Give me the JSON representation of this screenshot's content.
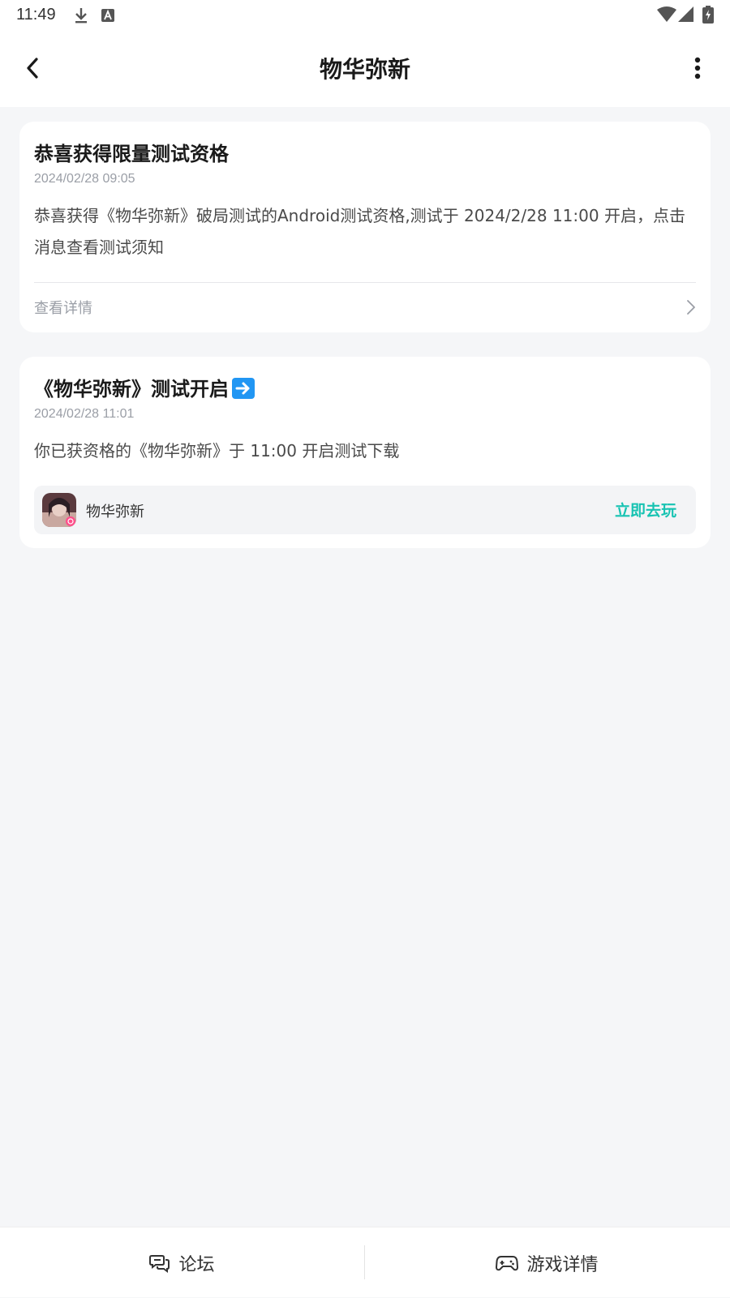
{
  "status_bar": {
    "time": "11:49",
    "icons": [
      "download-icon",
      "a-badge-icon",
      "wifi-icon",
      "signal-icon",
      "battery-icon"
    ]
  },
  "nav": {
    "title": "物华弥新",
    "back_icon": "chevron-left-icon",
    "more_icon": "more-vertical-icon"
  },
  "cards": [
    {
      "title": "恭喜获得限量测试资格",
      "time": "2024/02/28 09:05",
      "body": "恭喜获得《物华弥新》破局测试的Android测试资格,测试于 2024/2/28 11:00 开启，点击消息查看测试须知",
      "details_label": "查看详情"
    },
    {
      "title": "《物华弥新》测试开启",
      "title_emoji": "right-arrow-emoji",
      "time": "2024/02/28 11:01",
      "body": "你已获资格的《物华弥新》于 11:00 开启测试下载",
      "game": {
        "name": "物华弥新",
        "play_label": "立即去玩"
      }
    }
  ],
  "bottom_bar": {
    "tabs": [
      {
        "label": "论坛",
        "icon": "chat-bubbles-icon"
      },
      {
        "label": "游戏详情",
        "icon": "gamepad-icon"
      }
    ]
  },
  "colors": {
    "accent": "#17c3b2",
    "background": "#f5f6f8",
    "card": "#ffffff"
  }
}
